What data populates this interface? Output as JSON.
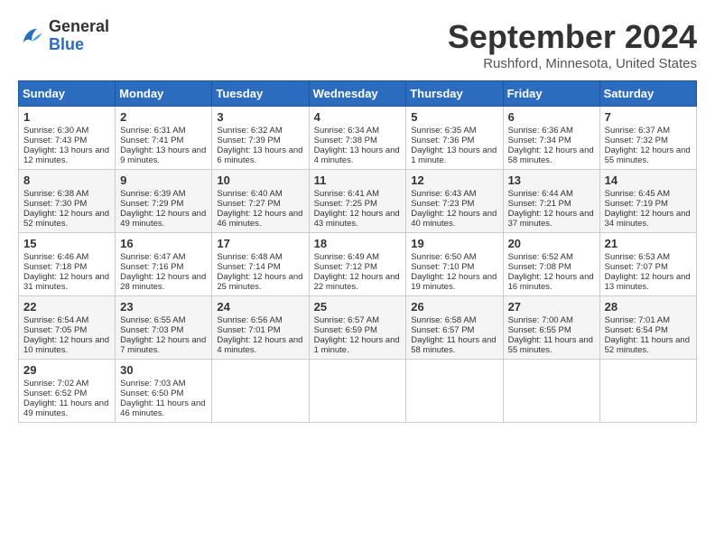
{
  "header": {
    "logo_general": "General",
    "logo_blue": "Blue",
    "month_title": "September 2024",
    "location": "Rushford, Minnesota, United States"
  },
  "calendar": {
    "days_of_week": [
      "Sunday",
      "Monday",
      "Tuesday",
      "Wednesday",
      "Thursday",
      "Friday",
      "Saturday"
    ],
    "weeks": [
      [
        {
          "day": "1",
          "sunrise": "6:30 AM",
          "sunset": "7:43 PM",
          "daylight": "13 hours and 12 minutes."
        },
        {
          "day": "2",
          "sunrise": "6:31 AM",
          "sunset": "7:41 PM",
          "daylight": "13 hours and 9 minutes."
        },
        {
          "day": "3",
          "sunrise": "6:32 AM",
          "sunset": "7:39 PM",
          "daylight": "13 hours and 6 minutes."
        },
        {
          "day": "4",
          "sunrise": "6:34 AM",
          "sunset": "7:38 PM",
          "daylight": "13 hours and 4 minutes."
        },
        {
          "day": "5",
          "sunrise": "6:35 AM",
          "sunset": "7:36 PM",
          "daylight": "13 hours and 1 minute."
        },
        {
          "day": "6",
          "sunrise": "6:36 AM",
          "sunset": "7:34 PM",
          "daylight": "12 hours and 58 minutes."
        },
        {
          "day": "7",
          "sunrise": "6:37 AM",
          "sunset": "7:32 PM",
          "daylight": "12 hours and 55 minutes."
        }
      ],
      [
        {
          "day": "8",
          "sunrise": "6:38 AM",
          "sunset": "7:30 PM",
          "daylight": "12 hours and 52 minutes."
        },
        {
          "day": "9",
          "sunrise": "6:39 AM",
          "sunset": "7:29 PM",
          "daylight": "12 hours and 49 minutes."
        },
        {
          "day": "10",
          "sunrise": "6:40 AM",
          "sunset": "7:27 PM",
          "daylight": "12 hours and 46 minutes."
        },
        {
          "day": "11",
          "sunrise": "6:41 AM",
          "sunset": "7:25 PM",
          "daylight": "12 hours and 43 minutes."
        },
        {
          "day": "12",
          "sunrise": "6:43 AM",
          "sunset": "7:23 PM",
          "daylight": "12 hours and 40 minutes."
        },
        {
          "day": "13",
          "sunrise": "6:44 AM",
          "sunset": "7:21 PM",
          "daylight": "12 hours and 37 minutes."
        },
        {
          "day": "14",
          "sunrise": "6:45 AM",
          "sunset": "7:19 PM",
          "daylight": "12 hours and 34 minutes."
        }
      ],
      [
        {
          "day": "15",
          "sunrise": "6:46 AM",
          "sunset": "7:18 PM",
          "daylight": "12 hours and 31 minutes."
        },
        {
          "day": "16",
          "sunrise": "6:47 AM",
          "sunset": "7:16 PM",
          "daylight": "12 hours and 28 minutes."
        },
        {
          "day": "17",
          "sunrise": "6:48 AM",
          "sunset": "7:14 PM",
          "daylight": "12 hours and 25 minutes."
        },
        {
          "day": "18",
          "sunrise": "6:49 AM",
          "sunset": "7:12 PM",
          "daylight": "12 hours and 22 minutes."
        },
        {
          "day": "19",
          "sunrise": "6:50 AM",
          "sunset": "7:10 PM",
          "daylight": "12 hours and 19 minutes."
        },
        {
          "day": "20",
          "sunrise": "6:52 AM",
          "sunset": "7:08 PM",
          "daylight": "12 hours and 16 minutes."
        },
        {
          "day": "21",
          "sunrise": "6:53 AM",
          "sunset": "7:07 PM",
          "daylight": "12 hours and 13 minutes."
        }
      ],
      [
        {
          "day": "22",
          "sunrise": "6:54 AM",
          "sunset": "7:05 PM",
          "daylight": "12 hours and 10 minutes."
        },
        {
          "day": "23",
          "sunrise": "6:55 AM",
          "sunset": "7:03 PM",
          "daylight": "12 hours and 7 minutes."
        },
        {
          "day": "24",
          "sunrise": "6:56 AM",
          "sunset": "7:01 PM",
          "daylight": "12 hours and 4 minutes."
        },
        {
          "day": "25",
          "sunrise": "6:57 AM",
          "sunset": "6:59 PM",
          "daylight": "12 hours and 1 minute."
        },
        {
          "day": "26",
          "sunrise": "6:58 AM",
          "sunset": "6:57 PM",
          "daylight": "11 hours and 58 minutes."
        },
        {
          "day": "27",
          "sunrise": "7:00 AM",
          "sunset": "6:55 PM",
          "daylight": "11 hours and 55 minutes."
        },
        {
          "day": "28",
          "sunrise": "7:01 AM",
          "sunset": "6:54 PM",
          "daylight": "11 hours and 52 minutes."
        }
      ],
      [
        {
          "day": "29",
          "sunrise": "7:02 AM",
          "sunset": "6:52 PM",
          "daylight": "11 hours and 49 minutes."
        },
        {
          "day": "30",
          "sunrise": "7:03 AM",
          "sunset": "6:50 PM",
          "daylight": "11 hours and 46 minutes."
        },
        null,
        null,
        null,
        null,
        null
      ]
    ]
  }
}
